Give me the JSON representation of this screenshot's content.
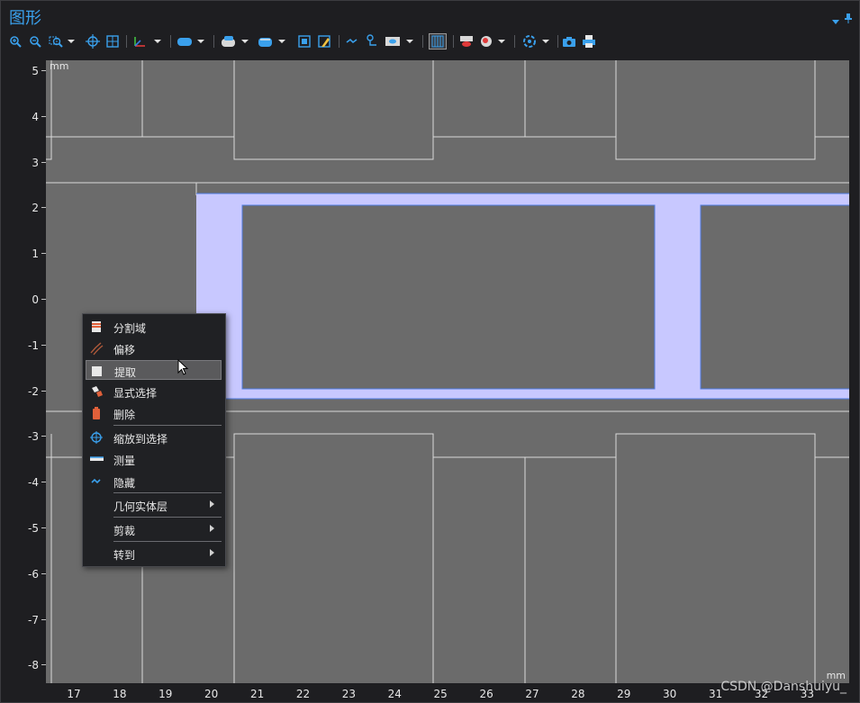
{
  "window": {
    "title": "图形"
  },
  "toolbar": {
    "icons": [
      "zoom-in-icon",
      "zoom-out-icon",
      "zoom-box-icon",
      "dropdown",
      "zoom-extents-icon",
      "zoom-selection-icon",
      "axis-orientation-icon",
      "dropdown",
      "select-domains-icon",
      "dropdown",
      "select-boundaries-icon",
      "dropdown",
      "select-objects-icon",
      "dropdown",
      "select-box-icon",
      "clear-selection-icon",
      "hide-icon",
      "link-icon",
      "view-icon",
      "dropdown",
      "wireframe-icon",
      "transparency-icon",
      "lighting-icon",
      "dropdown",
      "scene-icon",
      "dropdown",
      "camera-icon",
      "print-icon"
    ]
  },
  "plot": {
    "unit_y": "mm",
    "unit_x": "mm",
    "y_ticks": [
      "5",
      "4",
      "3",
      "2",
      "1",
      "0",
      "-1",
      "-2",
      "-3",
      "-4",
      "-5",
      "-6",
      "-7",
      "-8"
    ],
    "x_ticks": [
      "17",
      "18",
      "19",
      "20",
      "21",
      "22",
      "23",
      "24",
      "25",
      "26",
      "27",
      "28",
      "29",
      "30",
      "31",
      "32",
      "33"
    ],
    "colors": {
      "background": "#6b6b6b",
      "selection": "#c8c8ff",
      "edge": "#d8d8d8",
      "selected_edge": "#4f7be0"
    }
  },
  "context_menu": {
    "items": [
      {
        "label": "分割域",
        "icon": "split-domain-icon"
      },
      {
        "label": "偏移",
        "icon": "offset-icon"
      },
      {
        "label": "提取",
        "icon": "extract-icon",
        "highlighted": true
      },
      {
        "label": "显式选择",
        "icon": "explicit-selection-icon"
      },
      {
        "label": "删除",
        "icon": "delete-icon"
      },
      {
        "label": "缩放到选择",
        "icon": "zoom-to-selection-icon"
      },
      {
        "label": "测量",
        "icon": "measure-icon"
      },
      {
        "label": "隐藏",
        "icon": "hide-icon"
      },
      {
        "label": "几何实体层",
        "submenu": true
      },
      {
        "label": "剪裁",
        "submenu": true
      },
      {
        "label": "转到",
        "submenu": true
      }
    ]
  },
  "watermark": "CSDN @Danshuiyu_"
}
